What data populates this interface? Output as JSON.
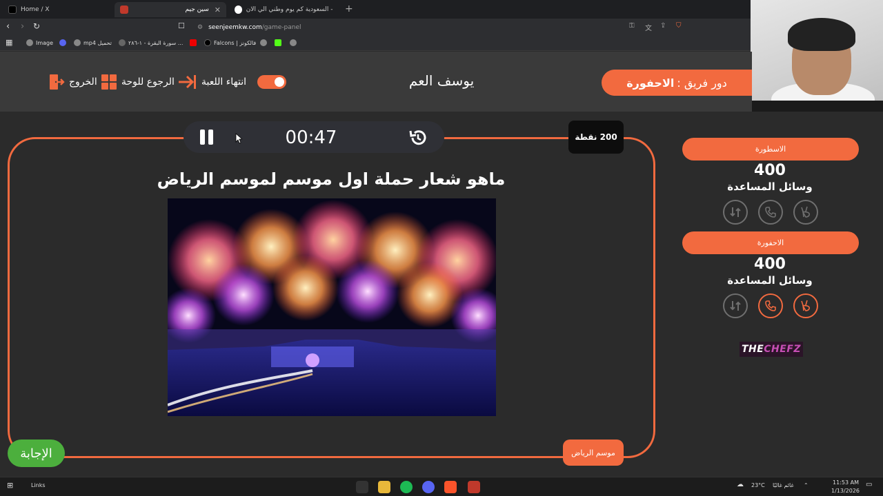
{
  "browser": {
    "tabs": [
      {
        "title": "Home / X",
        "icon": "x-icon"
      },
      {
        "title": "سين جيم",
        "icon": "seenjeem-logo-icon"
      },
      {
        "title": "السعودية كم يوم وطني الي الان - rch",
        "icon": "google-icon"
      }
    ],
    "url_host": "seenjeemkw.com",
    "url_path": "/game-panel",
    "bookmarks": [
      {
        "label": "Image",
        "icon": "globe-icon"
      },
      {
        "label": "mp4 تحميل",
        "icon": "globe-icon"
      },
      {
        "label": "سورة البقرة - ١-٢٨٦ ...",
        "icon": "youtube-icon"
      },
      {
        "label": "Falcons | فالكونز",
        "icon": "x-icon"
      }
    ]
  },
  "header": {
    "exit_label": "الخروج",
    "back_to_board_label": "الرجوع للوحة",
    "end_game_label": "انتهاء اللعبة",
    "player_name": "يوسف العم",
    "turn_prefix": "دور فريق :",
    "turn_team": "الاحفورة"
  },
  "question": {
    "timer": "00:47",
    "points_label": "200 نقطة",
    "text": "ماهو شعار حملة اول موسم لموسم الرياض",
    "category": "موسم الرياض",
    "answer_label": "الإجابة"
  },
  "teams": [
    {
      "name": "الاسطورة",
      "score": "400",
      "aids_label": "وسائل المساعدة",
      "aids_active": [
        false,
        false,
        false
      ]
    },
    {
      "name": "الاحفورة",
      "score": "400",
      "aids_label": "وسائل المساعدة",
      "aids_active": [
        false,
        true,
        true
      ]
    }
  ],
  "sponsor": {
    "brand_main": "THE",
    "brand_accent": "CHEFZ"
  },
  "taskbar": {
    "search_label": "Links",
    "weather": "23°C",
    "weather_desc": "غائم غالبًا",
    "time": "11:53 AM",
    "date": "1/13/2026"
  },
  "colors": {
    "accent": "#f26a3f",
    "background": "#2b2b2b",
    "header_bg": "#3a3a3a",
    "answer_green": "#4caf3d"
  }
}
